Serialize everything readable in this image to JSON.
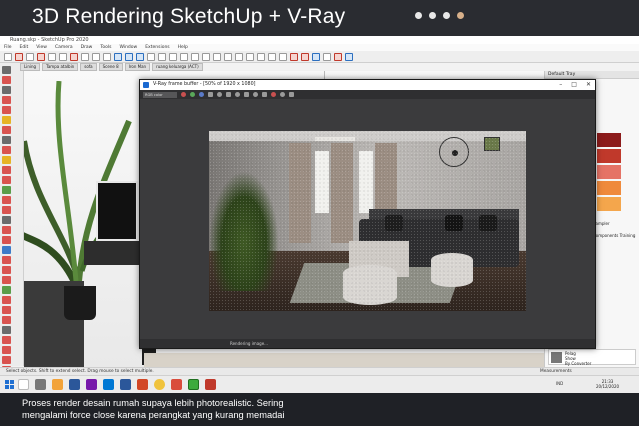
{
  "banner": {
    "title": "3D Rendering SketchUp + V-Ray",
    "page_indicator": {
      "count": 4,
      "active_index": 3,
      "active_color": "#d7b08a"
    }
  },
  "sketchup": {
    "window_title": "Ruang.skp - SketchUp Pro 2020",
    "menu": [
      "File",
      "Edit",
      "View",
      "Camera",
      "Draw",
      "Tools",
      "Window",
      "Extensions",
      "Help"
    ],
    "scenes": [
      "Lining",
      "Tampa atalbin",
      "sofa",
      "Scene 8",
      "Iron Man",
      "ruang keluarga (ACT)"
    ],
    "status_text": "Select objects. Shift to extend select. Drag mouse to select multiple.",
    "measurements_label": "Measurements",
    "tray": {
      "title": "Default Tray",
      "swatch_colors": [
        "#8c1b1b",
        "#c0392b",
        "#e57366",
        "#ef8a3c",
        "#f4a64c"
      ],
      "lines": [
        "Sampler",
        "",
        "Components Training"
      ],
      "user": {
        "name": "Pelag",
        "line2": "Pelag",
        "line3": "Show",
        "line4": "By Converter"
      }
    }
  },
  "vray": {
    "window_title": "V-Ray frame buffer - [50% of 1920 x 1080]",
    "channel_select": "RGB color",
    "status_text": "Rendering image..."
  },
  "taskbar": {
    "time": "21:33",
    "date": "20/12/2020",
    "lang": "IND",
    "icon_colors": [
      "#0078d4",
      "#c84a2a",
      "#6b6b6b",
      "#f2a33a",
      "#2b579a",
      "#2b579a",
      "#d24726",
      "#1e8c3a",
      "#d94c3c",
      "#f0c33c",
      "#3daa3d",
      "#c0392b"
    ]
  },
  "caption": {
    "line1": "Proses render desain rumah supaya lebih photorealistic. Sering",
    "line2": "mengalami force close karena perangkat yang kurang memadai"
  }
}
